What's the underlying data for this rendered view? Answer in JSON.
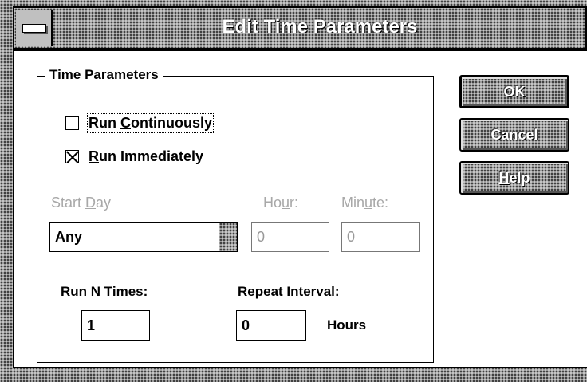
{
  "window": {
    "title": "Edit Time Parameters"
  },
  "group": {
    "title": "Time Parameters"
  },
  "checkboxes": {
    "run_continuously": {
      "label_prefix": "Run ",
      "label_underline": "C",
      "label_rest": "ontinuously",
      "checked": false
    },
    "run_immediately": {
      "label_underline": "R",
      "label_rest": "un Immediately",
      "checked": true
    }
  },
  "start_day": {
    "label_prefix": "Start ",
    "label_underline": "D",
    "label_rest": "ay",
    "value": "Any"
  },
  "hour": {
    "label_prefix": "Ho",
    "label_underline": "u",
    "label_rest": "r:",
    "value": "0"
  },
  "minute": {
    "label_prefix": "Min",
    "label_underline": "u",
    "label_rest": "te:",
    "value": "0"
  },
  "run_n_times": {
    "label_prefix": "Run ",
    "label_underline": "N",
    "label_rest": " Times:",
    "value": "1"
  },
  "repeat_interval": {
    "label_prefix": "Repeat ",
    "label_underline": "I",
    "label_rest": "nterval:",
    "value": "0",
    "unit": "Hours"
  },
  "buttons": {
    "ok": "OK",
    "cancel": "Cancel",
    "help_underline": "H",
    "help_rest": "elp"
  }
}
